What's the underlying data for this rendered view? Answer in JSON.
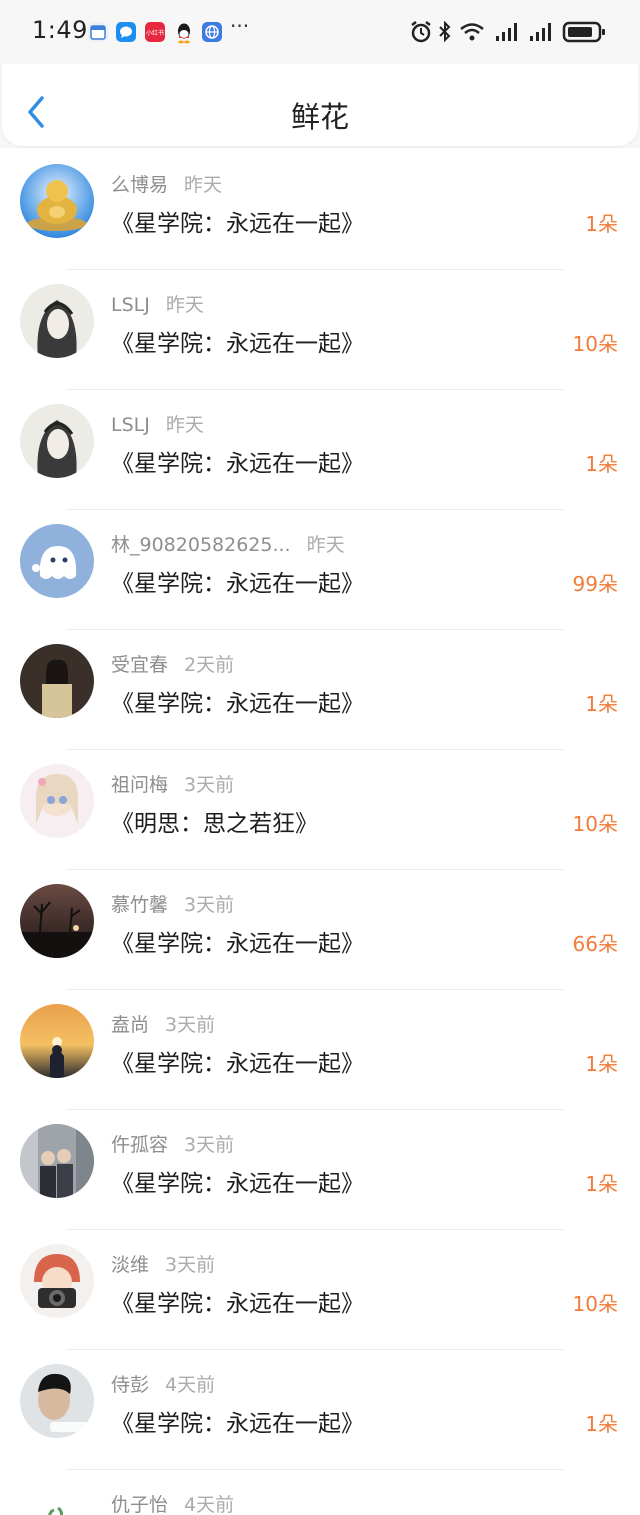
{
  "status_bar": {
    "time": "1:49",
    "notification_icons": [
      "calendar-icon",
      "message-icon",
      "xiaohongshu-icon",
      "qq-icon",
      "browser-icon"
    ],
    "overflow": "···",
    "system_icons": [
      "alarm-icon",
      "bluetooth-icon",
      "wifi-icon",
      "signal-icon",
      "signal-icon",
      "battery-icon"
    ],
    "xhs_label": "小红书"
  },
  "header": {
    "title": "鲜花",
    "back_icon": "chevron-left-icon"
  },
  "colors": {
    "accent": "#2f8fe5",
    "count": "#f07b3a",
    "meta": "#8e8e8e",
    "time": "#ababab"
  },
  "flowers": [
    {
      "name": "么博易",
      "time": "昨天",
      "book": "《星学院：永远在一起》",
      "count": "1朵"
    },
    {
      "name": "LSLJ",
      "time": "昨天",
      "book": "《星学院：永远在一起》",
      "count": "10朵"
    },
    {
      "name": "LSLJ",
      "time": "昨天",
      "book": "《星学院：永远在一起》",
      "count": "1朵"
    },
    {
      "name": "林_90820582625...",
      "time": "昨天",
      "book": "《星学院：永远在一起》",
      "count": "99朵"
    },
    {
      "name": "受宜春",
      "time": "2天前",
      "book": "《星学院：永远在一起》",
      "count": "1朵"
    },
    {
      "name": "祖问梅",
      "time": "3天前",
      "book": "《明思：思之若狂》",
      "count": "10朵"
    },
    {
      "name": "慕竹馨",
      "time": "3天前",
      "book": "《星学院：永远在一起》",
      "count": "66朵"
    },
    {
      "name": "盍尚",
      "time": "3天前",
      "book": "《星学院：永远在一起》",
      "count": "1朵"
    },
    {
      "name": "仵孤容",
      "time": "3天前",
      "book": "《星学院：永远在一起》",
      "count": "1朵"
    },
    {
      "name": "淡维",
      "time": "3天前",
      "book": "《星学院：永远在一起》",
      "count": "10朵"
    },
    {
      "name": "侍彭",
      "time": "4天前",
      "book": "《星学院：永远在一起》",
      "count": "1朵"
    },
    {
      "name": "仇子怡",
      "time": "4天前",
      "book": "",
      "count": ""
    }
  ]
}
